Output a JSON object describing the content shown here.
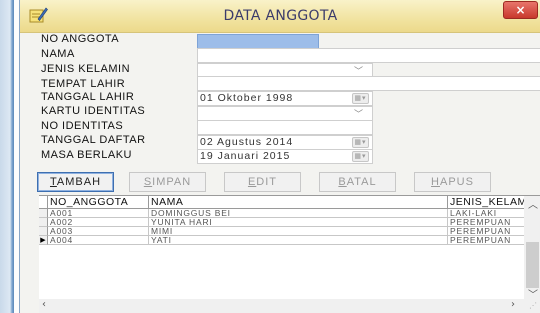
{
  "window": {
    "title": "DATA ANGGOTA",
    "close_label": "×"
  },
  "form": {
    "labels": {
      "no_anggota": "NO ANGGOTA",
      "nama": "NAMA",
      "jenis_kelamin": "JENIS KELAMIN",
      "tempat_lahir": "TEMPAT LAHIR",
      "tanggal_lahir": "TANGGAL LAHIR",
      "kartu_identitas": "KARTU IDENTITAS",
      "no_identitas": "NO IDENTITAS",
      "tanggal_daftar": "TANGGAL DAFTAR",
      "masa_berlaku": "MASA BERLAKU"
    },
    "values": {
      "no_anggota": "",
      "nama": "",
      "jenis_kelamin": "",
      "tempat_lahir": "",
      "tanggal_lahir": "01  Oktober   1998",
      "kartu_identitas": "",
      "no_identitas": "",
      "tanggal_daftar": "02  Agustus   2014",
      "masa_berlaku": "19  Januari   2015"
    }
  },
  "buttons": {
    "tambah": {
      "hot": "T",
      "rest": "AMBAH"
    },
    "simpan": {
      "hot": "S",
      "rest": "IMPAN"
    },
    "edit": {
      "hot": "E",
      "rest": "DIT"
    },
    "batal": {
      "hot": "B",
      "rest": "ATAL"
    },
    "hapus": {
      "hot": "H",
      "rest": "APUS"
    }
  },
  "grid": {
    "columns": [
      "NO_ANGGOTA",
      "NAMA",
      "JENIS_KELAM"
    ],
    "rows": [
      [
        "A001",
        "DOMINGGUS BEI",
        "LAKI-LAKI"
      ],
      [
        "A002",
        "YUNITA HARI",
        "PEREMPUAN"
      ],
      [
        "A003",
        "MIMI",
        "PEREMPUAN"
      ],
      [
        "A004",
        "YATI",
        "PEREMPUAN"
      ]
    ],
    "current_row_marker": "▶"
  },
  "icons": {
    "app": "pencil-notepad-icon",
    "dropdown": "chevron-down-icon",
    "calendar": "calendar-dropdown-icon"
  },
  "colors": {
    "titlebar": "#f1e3a0",
    "close": "#c8382c",
    "selected_field": "#9dbde9",
    "active_button_border": "#3e6fb0"
  }
}
